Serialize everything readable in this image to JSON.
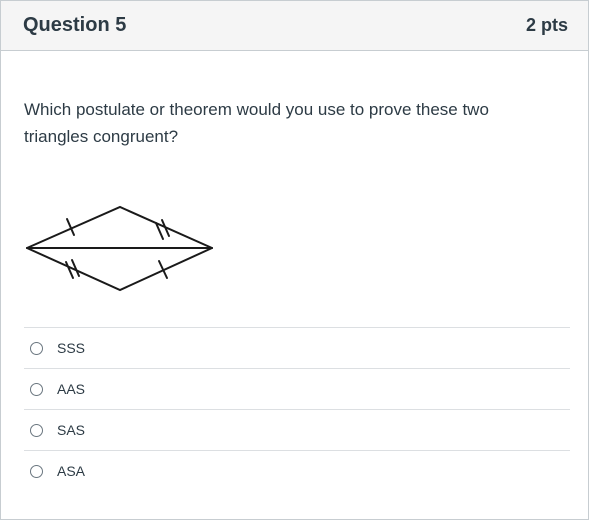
{
  "question": {
    "title": "Question 5",
    "points": "2 pts",
    "text": "Which postulate or theorem would you use to prove these two triangles congruent?"
  },
  "figure": {
    "icon": "rhombus-triangles-diagram"
  },
  "answers": [
    {
      "label": "SSS",
      "selected": false
    },
    {
      "label": "AAS",
      "selected": false
    },
    {
      "label": "SAS",
      "selected": false
    },
    {
      "label": "ASA",
      "selected": false
    }
  ]
}
